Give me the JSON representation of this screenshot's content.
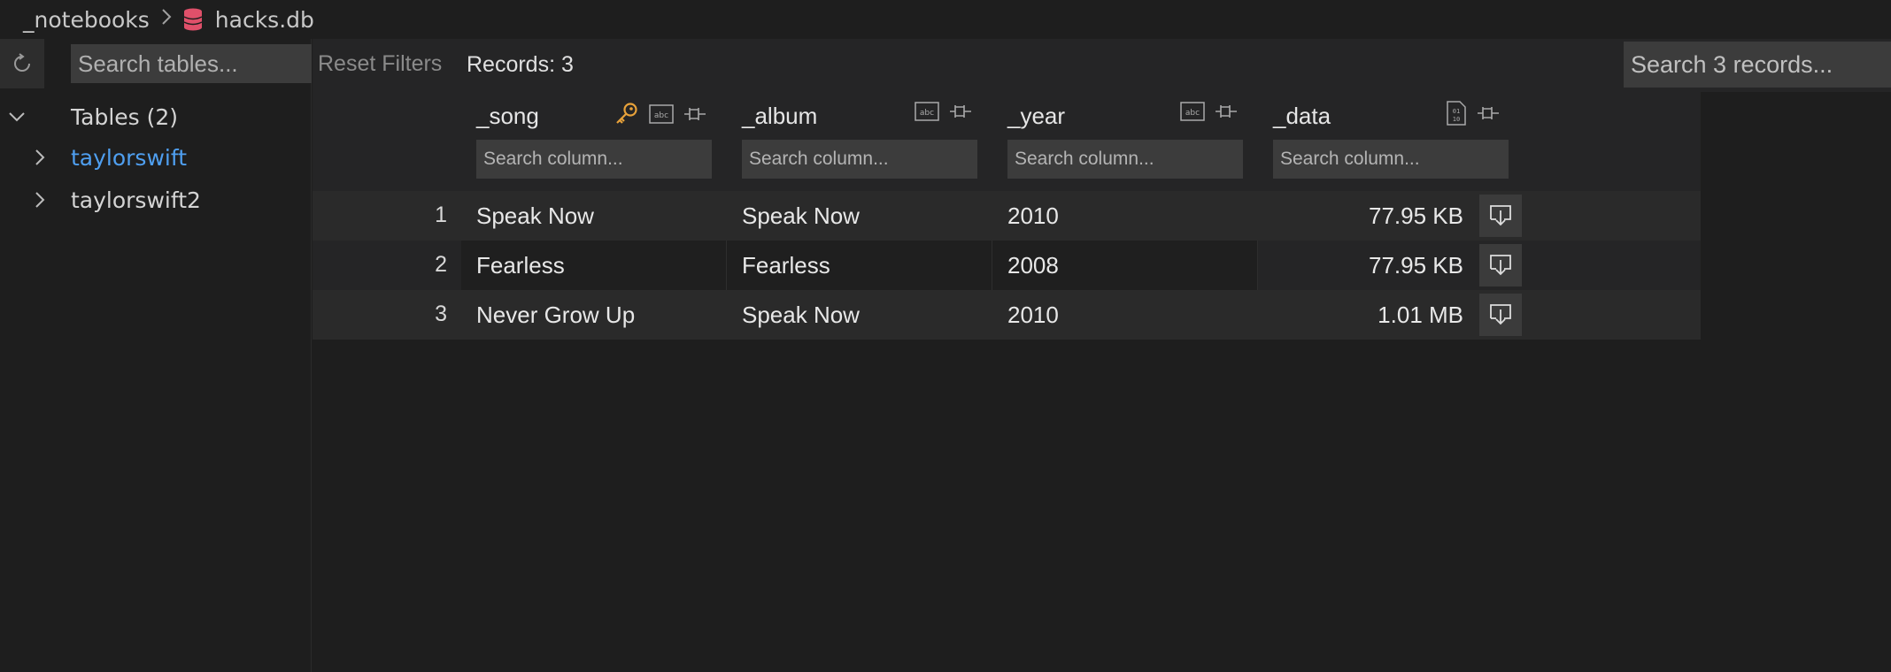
{
  "breadcrumb": {
    "folder": "_notebooks",
    "file": "hacks.db"
  },
  "sidebar": {
    "search_placeholder": "Search tables...",
    "tables_header": "Tables (2)",
    "tables": [
      {
        "name": "taylorswift",
        "active": true
      },
      {
        "name": "taylorswift2",
        "active": false
      }
    ]
  },
  "toolbar": {
    "reset_label": "Reset Filters",
    "records_label": "Records: 3",
    "search_placeholder": "Search 3 records..."
  },
  "columns": [
    {
      "name": "_song",
      "type_icon": "abc-icon",
      "key": true,
      "search_placeholder": "Search column..."
    },
    {
      "name": "_album",
      "type_icon": "abc-icon",
      "key": false,
      "search_placeholder": "Search column..."
    },
    {
      "name": "_year",
      "type_icon": "abc-icon",
      "key": false,
      "search_placeholder": "Search column..."
    },
    {
      "name": "_data",
      "type_icon": "binary-icon",
      "key": false,
      "search_placeholder": "Search column..."
    }
  ],
  "rows": [
    {
      "num": "1",
      "song": "Speak Now",
      "album": "Speak Now",
      "year": "2010",
      "data": "77.95 KB"
    },
    {
      "num": "2",
      "song": "Fearless",
      "album": "Fearless",
      "year": "2008",
      "data": "77.95 KB"
    },
    {
      "num": "3",
      "song": "Never Grow Up",
      "album": "Speak Now",
      "year": "2010",
      "data": "1.01 MB"
    }
  ],
  "colors": {
    "accent": "#4f9ff0",
    "key": "#e8a23a",
    "db_icon": "#e0506a"
  }
}
